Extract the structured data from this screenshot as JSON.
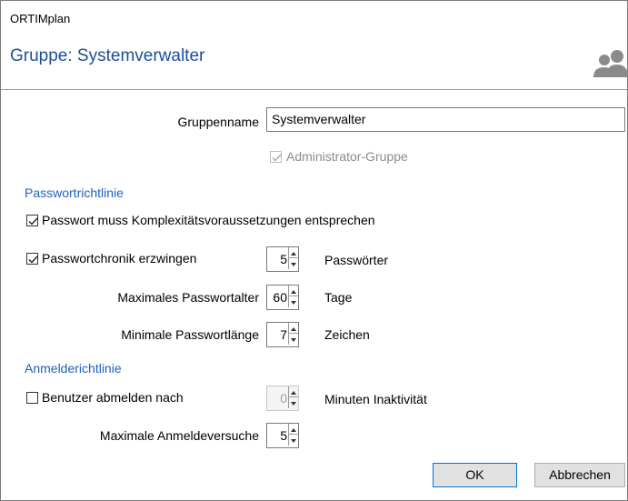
{
  "window": {
    "app_title": "ORTIMplan"
  },
  "header": {
    "title": "Gruppe: Systemverwalter",
    "icon": "user-group-icon"
  },
  "form": {
    "group_name_label": "Gruppenname",
    "group_name_value": "Systemverwalter",
    "admin_group_label": "Administrator-Gruppe",
    "admin_group_checked": true,
    "admin_group_disabled": true
  },
  "password_policy": {
    "section_title": "Passwortrichtlinie",
    "complexity_label": "Passwort muss Komplexitätsvoraussetzungen entsprechen",
    "complexity_checked": true,
    "history_label": "Passwortchronik erzwingen",
    "history_checked": true,
    "history_value": "5",
    "history_unit": "Passwörter",
    "max_age_label": "Maximales Passwortalter",
    "max_age_value": "60",
    "max_age_unit": "Tage",
    "min_length_label": "Minimale Passwortlänge",
    "min_length_value": "7",
    "min_length_unit": "Zeichen"
  },
  "login_policy": {
    "section_title": "Anmelderichtlinie",
    "logout_label": "Benutzer abmelden nach",
    "logout_checked": false,
    "logout_value": "0",
    "logout_unit": "Minuten Inaktivität",
    "max_attempts_label": "Maximale Anmeldeversuche",
    "max_attempts_value": "5"
  },
  "buttons": {
    "ok_label": "OK",
    "cancel_label": "Abbrechen"
  }
}
